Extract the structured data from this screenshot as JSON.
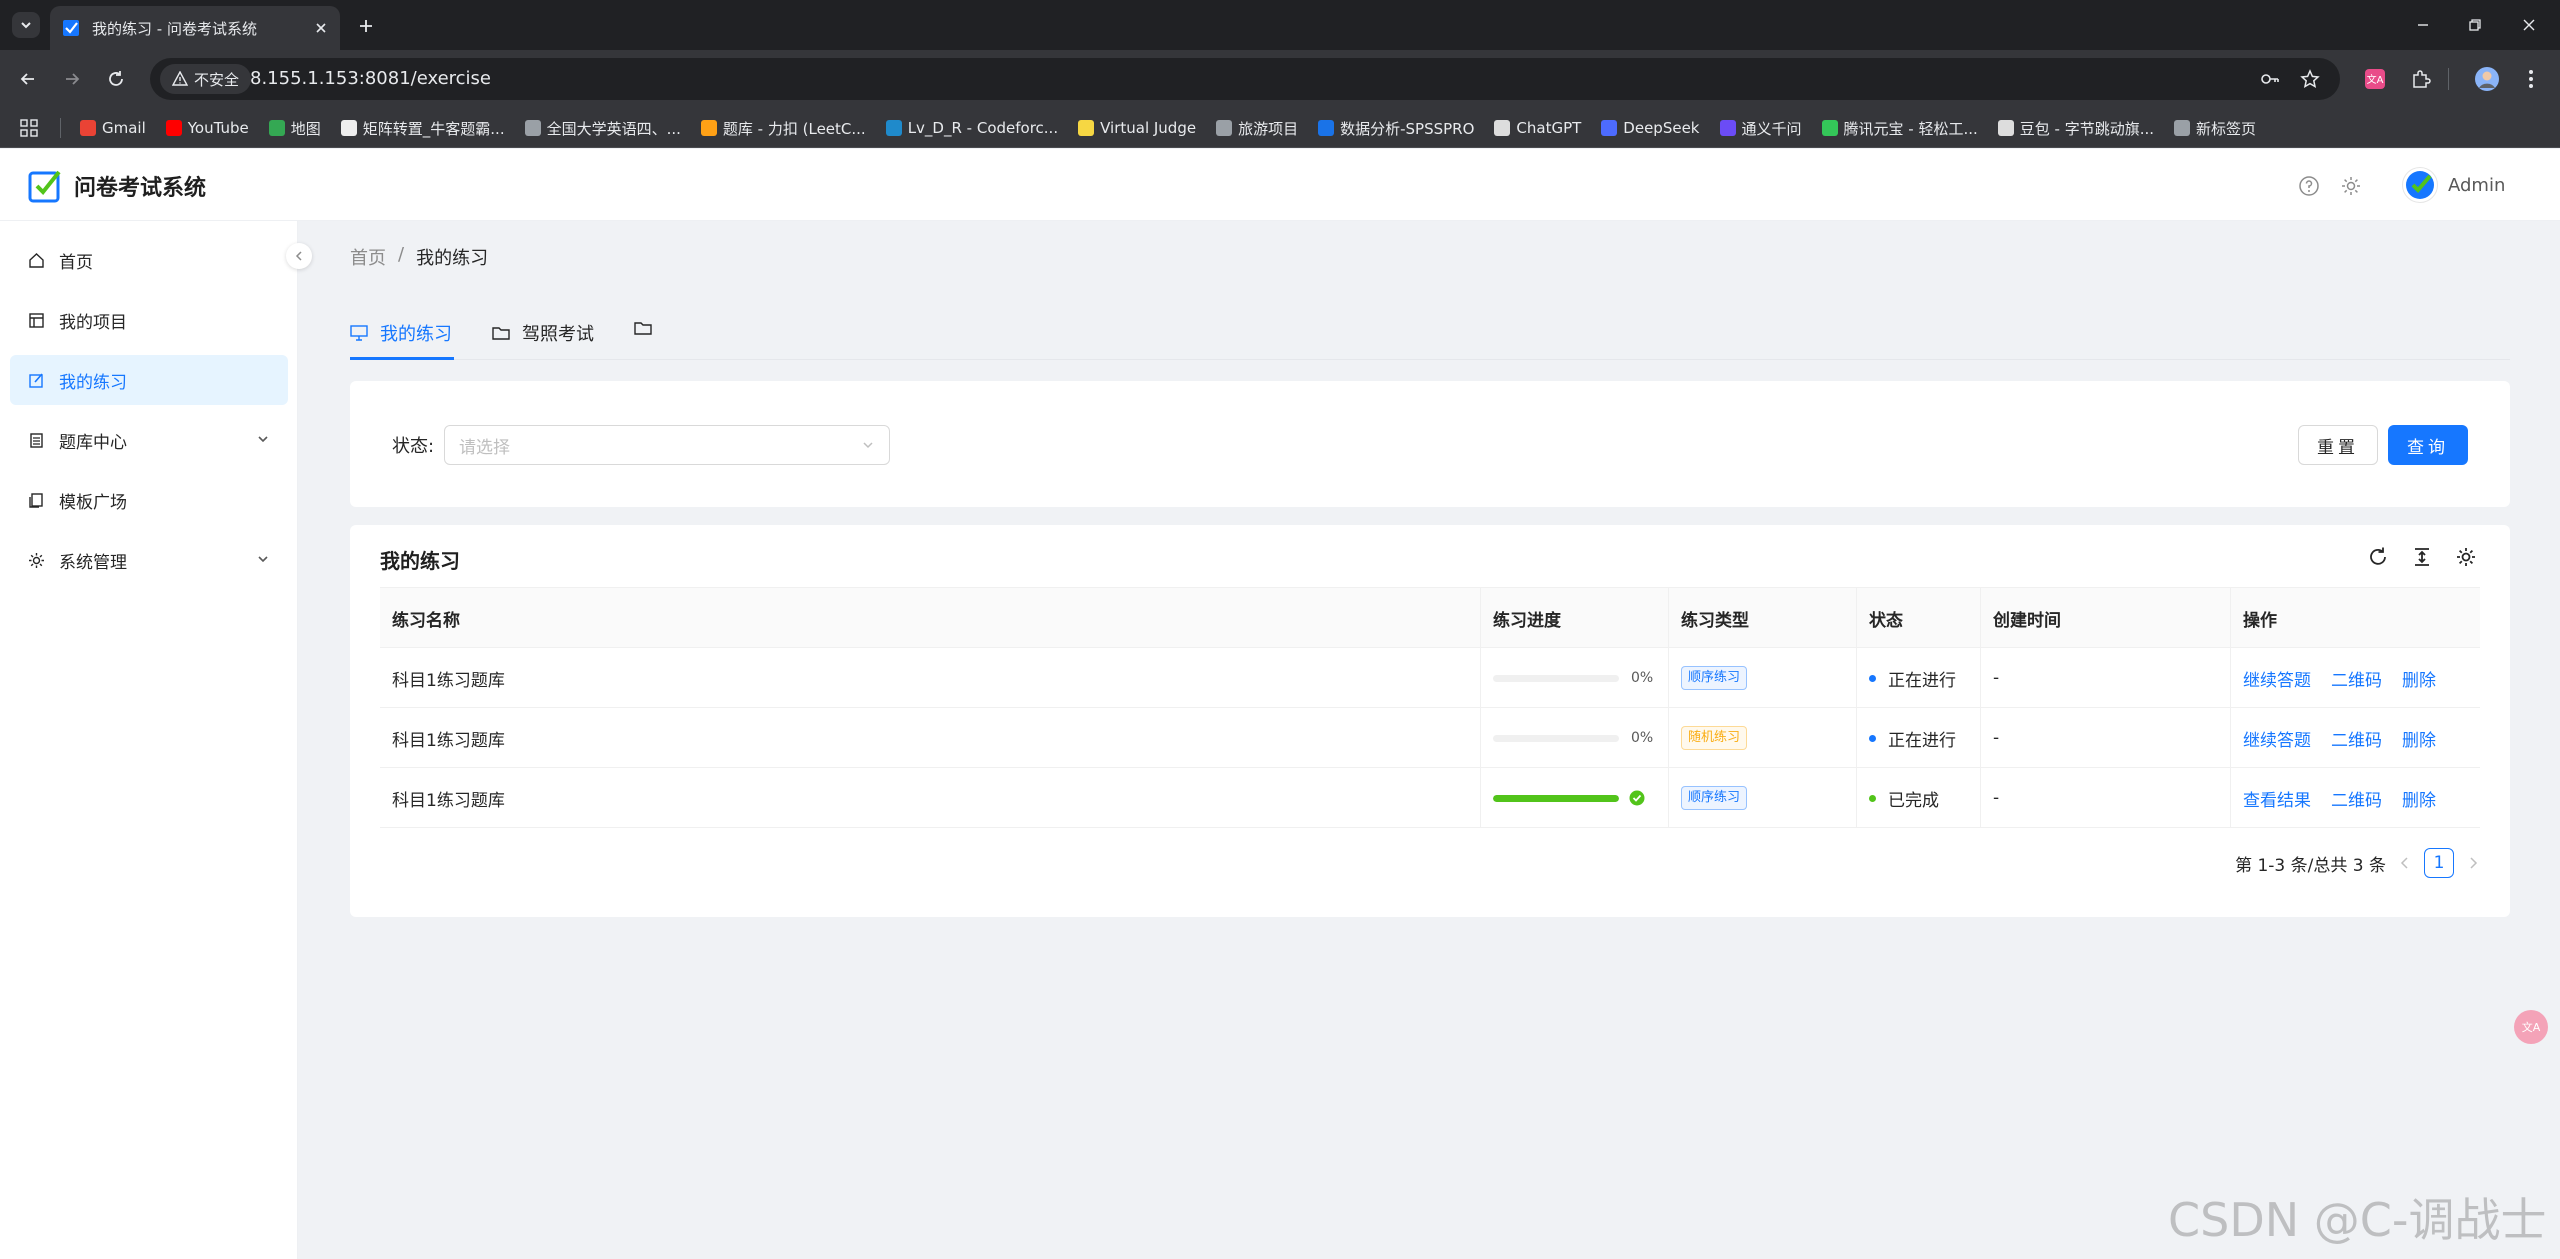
{
  "browser": {
    "tab_title": "我的练习 - 问卷考试系统",
    "security_label": "不安全",
    "url": "8.155.1.153:8081/exercise",
    "bookmarks": [
      {
        "label": "Gmail",
        "color": "#ea4335"
      },
      {
        "label": "YouTube",
        "color": "#ff0000"
      },
      {
        "label": "地图",
        "color": "#34a853"
      },
      {
        "label": "矩阵转置_牛客题霸...",
        "color": "#eeeeee"
      },
      {
        "label": "全国大学英语四、...",
        "color": "#9aa0a6"
      },
      {
        "label": "题库 - 力扣 (LeetC...",
        "color": "#ffa116"
      },
      {
        "label": "Lv_D_R - Codeforc...",
        "color": "#1f8acb"
      },
      {
        "label": "Virtual Judge",
        "color": "#f6d743"
      },
      {
        "label": "旅游项目",
        "color": "#9aa0a6"
      },
      {
        "label": "数据分析-SPSSPRO",
        "color": "#1a73e8"
      },
      {
        "label": "ChatGPT",
        "color": "#dddddd"
      },
      {
        "label": "DeepSeek",
        "color": "#4d6bfe"
      },
      {
        "label": "通义千问",
        "color": "#6b4cf6"
      },
      {
        "label": "腾讯元宝 - 轻松工...",
        "color": "#34c759"
      },
      {
        "label": "豆包 - 字节跳动旗...",
        "color": "#dddddd"
      },
      {
        "label": "新标签页",
        "color": "#9aa0a6"
      }
    ]
  },
  "app": {
    "title": "问卷考试系统",
    "user_name": "Admin",
    "accent": "#1677ff"
  },
  "sidebar": {
    "items": [
      {
        "label": "首页",
        "icon": "home-icon"
      },
      {
        "label": "我的项目",
        "icon": "project-icon"
      },
      {
        "label": "我的练习",
        "icon": "edit-icon",
        "active": true
      },
      {
        "label": "题库中心",
        "icon": "list-icon",
        "has_children": true
      },
      {
        "label": "模板广场",
        "icon": "template-icon"
      },
      {
        "label": "系统管理",
        "icon": "gear-icon",
        "has_children": true
      }
    ]
  },
  "breadcrumb": {
    "home": "首页",
    "separator": "/",
    "current": "我的练习"
  },
  "tabs": [
    {
      "label": "我的练习",
      "icon": "desktop-icon",
      "active": true
    },
    {
      "label": "驾照考试",
      "icon": "folder-icon"
    },
    {
      "label": "",
      "icon": "folder-icon"
    }
  ],
  "search": {
    "status_label": "状态:",
    "status_placeholder": "请选择",
    "reset_label": "重置",
    "query_label": "查询"
  },
  "table": {
    "title": "我的练习",
    "columns": [
      "练习名称",
      "练习进度",
      "练习类型",
      "状态",
      "创建时间",
      "操作"
    ],
    "rows": [
      {
        "name": "科目1练习题库",
        "progress": 0,
        "progress_text": "0%",
        "type": "顺序练习",
        "type_color": "#1677ff",
        "status": "正在进行",
        "status_color": "#1677ff",
        "created": "-",
        "actions": [
          "继续答题",
          "二维码",
          "删除"
        ]
      },
      {
        "name": "科目1练习题库",
        "progress": 0,
        "progress_text": "0%",
        "type": "随机练习",
        "type_color": "#faad14",
        "status": "正在进行",
        "status_color": "#1677ff",
        "created": "-",
        "actions": [
          "继续答题",
          "二维码",
          "删除"
        ]
      },
      {
        "name": "科目1练习题库",
        "progress": 100,
        "progress_text": "",
        "type": "顺序练习",
        "type_color": "#1677ff",
        "status": "已完成",
        "status_color": "#52c41a",
        "created": "-",
        "actions": [
          "查看结果",
          "二维码",
          "删除"
        ]
      }
    ],
    "pagination": {
      "summary": "第 1-3 条/总共 3 条",
      "current_page": "1"
    }
  },
  "watermark": "CSDN @C-调战士"
}
